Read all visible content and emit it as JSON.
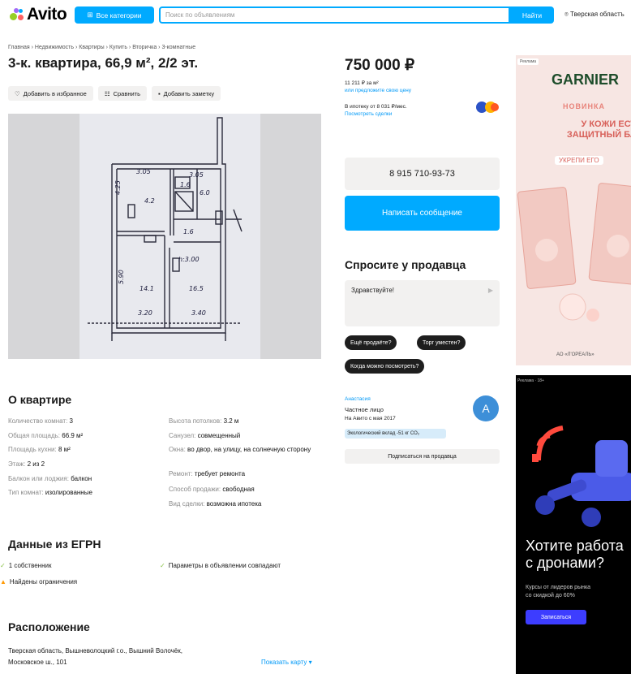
{
  "header": {
    "logo": "Avito",
    "categories_label": "Все категории",
    "search_placeholder": "Поиск по объявлениям",
    "search_button": "Найти",
    "region": "Тверская областъ"
  },
  "breadcrumb": "Главная › Недвижимость › Квартиры › Купить › Вторичка › 3-комнатные",
  "listing": {
    "title": "3-к. квартира, 66,9 м², 2/2 эт.",
    "actions": [
      "Добавить в избранное",
      "Сравнить",
      "Добавить заметку"
    ]
  },
  "floorplan_labels": [
    "3.05",
    "3.05",
    "4.25",
    "6.0",
    "4.2",
    "1.6",
    "1.6",
    "h:3.00",
    "5.90",
    "14.1",
    "16.5",
    "3.20",
    "3.40"
  ],
  "about": {
    "heading": "О квартире",
    "left": [
      {
        "k": "Количество комнат:",
        "v": "3"
      },
      {
        "k": "Общая площадь:",
        "v": "66.9 м²"
      },
      {
        "k": "Площадь кухни:",
        "v": "8 м²"
      },
      {
        "k": "Этаж:",
        "v": "2 из 2"
      },
      {
        "k": "Балкон или лоджия:",
        "v": "балкон"
      },
      {
        "k": "Тип комнат:",
        "v": "изолированные"
      }
    ],
    "right": [
      {
        "k": "Высота потолков:",
        "v": "3.2 м"
      },
      {
        "k": "Санузел:",
        "v": "совмещенный"
      },
      {
        "k": "Окна:",
        "v": "во двор, на улицу, на солнечную сторону"
      },
      {
        "k": "Ремонт:",
        "v": "требует ремонта"
      },
      {
        "k": "Способ продажи:",
        "v": "свободная"
      },
      {
        "k": "Вид сделки:",
        "v": "возможна ипотека"
      }
    ]
  },
  "egrn": {
    "heading": "Данные из ЕГРН",
    "owners": "1 собственник",
    "match": "Параметры в объявлении совпадают",
    "restrictions": "Найдены ограничения"
  },
  "location": {
    "heading": "Расположение",
    "line1": "Тверская область, Вышневолоцкий г.о., Вышний Волочёк,",
    "line2": "Московское ш., 101",
    "map_link": "Показать карту ▾"
  },
  "price": {
    "value": "750 000 ₽",
    "per_m2": "11 211 ₽ за м²",
    "offer_link": "или предложите свою цену",
    "mortgage": "В ипотеку от 8 031 ₽/мес.",
    "mortgage_link": "Посмотреть сделки"
  },
  "contact": {
    "phone": "8 915 710-93-73",
    "message_button": "Написать сообщение"
  },
  "ask": {
    "heading": "Спросите у продавца",
    "input": "Здравствуйте!",
    "chips": [
      "Ещё продаёте?",
      "Торг уместен?",
      "Когда можно посмотреть?"
    ]
  },
  "seller": {
    "name": "Анастасия",
    "type": "Частное лицо",
    "since": "На Авито с мая 2017",
    "avatar_letter": "A",
    "eco": "Экологический вклад -51 кг CO₂",
    "subscribe": "Подписаться на продавца"
  },
  "ad1": {
    "tag": "Реклама",
    "brand": "GARNIER",
    "t1": "НОВИНКА",
    "t2": "У КОЖИ ЕСТЬ ЗАЩИТНЫЙ БАР",
    "t3": "УКРЕПИ ЕГО",
    "footer": "АО «Л'ОРЕАЛЬ»"
  },
  "ad2": {
    "tag": "Реклама · 18+",
    "title_line1": "Хотите работа",
    "title_line2": "с дронами?",
    "text_line1": "Курсы от лидеров рынка",
    "text_line2": "со скидкой до 60%",
    "button": "Записаться"
  },
  "colors": {
    "accent": "#00aaff",
    "link": "#0099f7",
    "muted": "#8a8a8a"
  }
}
